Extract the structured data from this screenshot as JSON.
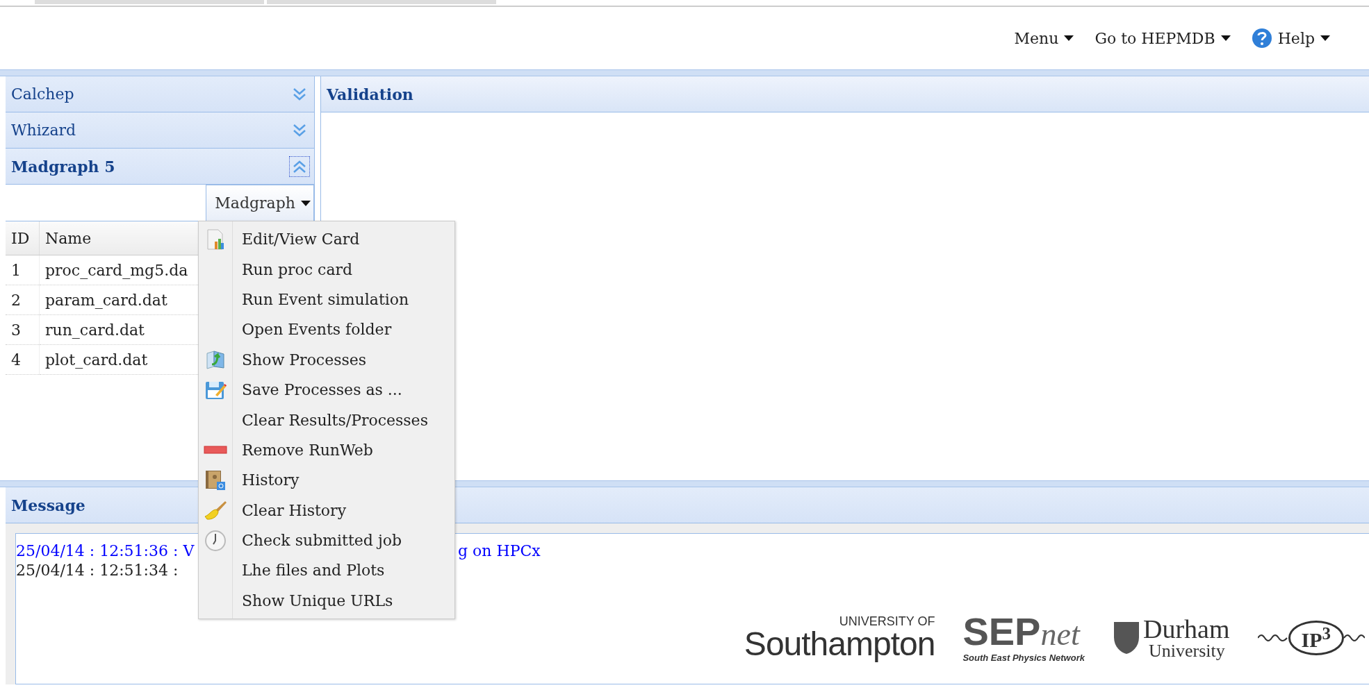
{
  "nav": [
    {
      "label": "Menu",
      "kind": "plain"
    },
    {
      "label": "Go to HEPMDB",
      "kind": "plain"
    },
    {
      "label": "Help",
      "kind": "help"
    }
  ],
  "accordion": [
    {
      "title": "Calchep",
      "expanded": false
    },
    {
      "title": "Whizard",
      "expanded": false
    },
    {
      "title": "Madgraph 5",
      "expanded": true
    }
  ],
  "toolbar": {
    "button": "Madgraph"
  },
  "table": {
    "columns": [
      "ID",
      "Name"
    ],
    "rows": [
      [
        "1",
        "proc_card_mg5.da"
      ],
      [
        "2",
        "param_card.dat"
      ],
      [
        "3",
        "run_card.dat"
      ],
      [
        "4",
        "plot_card.dat"
      ]
    ]
  },
  "validation": {
    "title": "Validation"
  },
  "menu": [
    {
      "label": "Edit/View Card",
      "kind": "doc"
    },
    {
      "label": "Run proc card",
      "kind": "none"
    },
    {
      "label": "Run Event simulation",
      "kind": "none"
    },
    {
      "label": "Open Events folder",
      "kind": "none"
    },
    {
      "label": "Show Processes",
      "kind": "swap"
    },
    {
      "label": "Save Processes as ...",
      "kind": "save"
    },
    {
      "label": "Clear Results/Processes",
      "kind": "none"
    },
    {
      "label": "Remove RunWeb",
      "kind": "remove"
    },
    {
      "label": "History",
      "kind": "book"
    },
    {
      "label": "Clear History",
      "kind": "brush"
    },
    {
      "label": "Check submitted job",
      "kind": "clock"
    },
    {
      "label": "Lhe files and Plots",
      "kind": "none"
    },
    {
      "label": "Show Unique URLs",
      "kind": "none"
    }
  ],
  "message": {
    "title": "Message",
    "lines": [
      {
        "parts": [
          "25/04/14 : 12:51:36 : V",
          "g on HPCx"
        ],
        "color": "#0000ff"
      },
      {
        "parts": [
          "25/04/14 : 12:51:34 :"
        ],
        "color": "#222222"
      }
    ]
  },
  "logos": [
    {
      "kind": "southampton",
      "texts": [
        "UNIVERSITY OF",
        "Southampton"
      ]
    },
    {
      "kind": "sepnet",
      "texts": [
        "SEP",
        "net",
        "South East Physics Network"
      ]
    },
    {
      "kind": "durham",
      "texts": [
        "Durham",
        "University"
      ]
    },
    {
      "kind": "ip3",
      "texts": [
        "IP",
        "3"
      ]
    }
  ]
}
